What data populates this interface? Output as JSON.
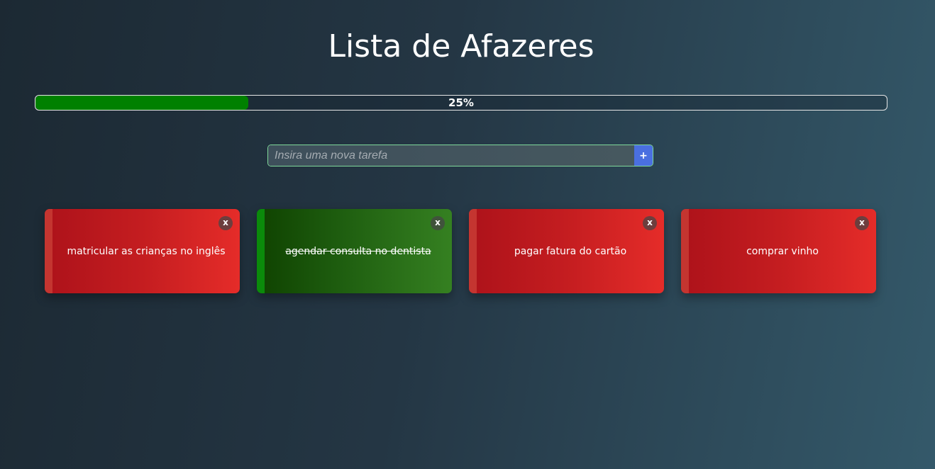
{
  "header": {
    "title": "Lista de Afazeres"
  },
  "progress": {
    "value": 0.25,
    "text": "25%",
    "fill_color": "#008000"
  },
  "form": {
    "input_placeholder": "Insira uma nova tarefa",
    "input_value": "",
    "add_label": "+"
  },
  "tasks": [
    {
      "label": "matricular as crianças no inglês",
      "done": false,
      "close_label": "x"
    },
    {
      "label": "agendar consulta no dentista",
      "done": true,
      "close_label": "x"
    },
    {
      "label": "pagar fatura do cartão",
      "done": false,
      "close_label": "x"
    },
    {
      "label": "comprar vinho",
      "done": false,
      "close_label": "x"
    }
  ],
  "colors": {
    "pending": "#d21f22",
    "done": "#1f5f10",
    "accent": "#4a6fe0"
  }
}
